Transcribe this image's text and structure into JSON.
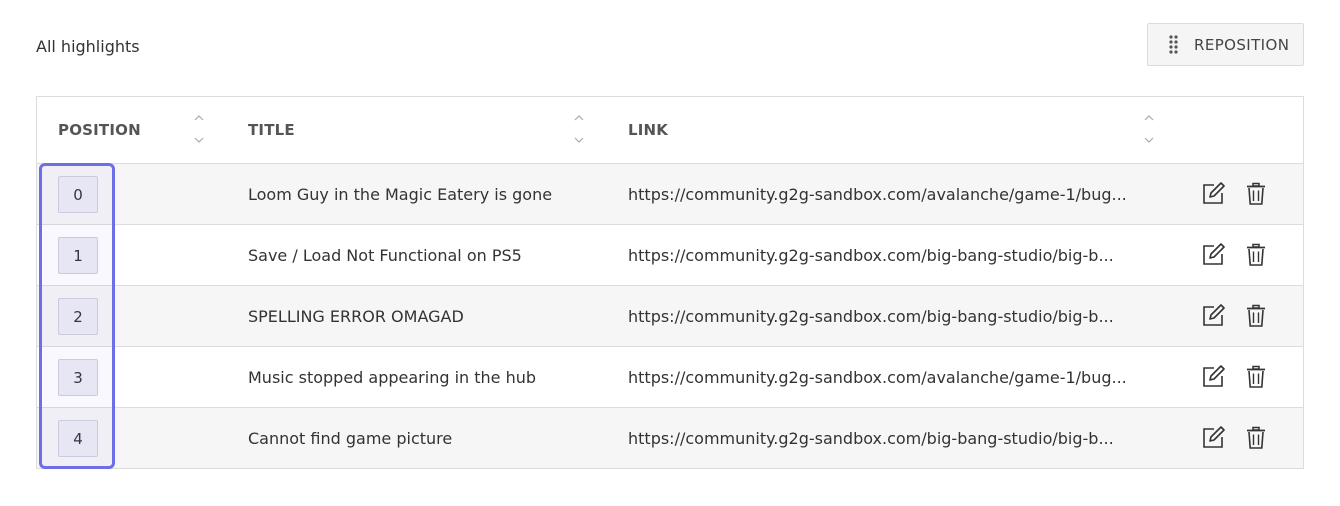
{
  "header": {
    "title": "All highlights",
    "reposition_label": "REPOSITION"
  },
  "table": {
    "columns": {
      "position": "POSITION",
      "title": "TITLE",
      "link": "LINK"
    },
    "rows": [
      {
        "position": "0",
        "title": "Loom Guy in the Magic Eatery is gone",
        "link": "https://community.g2g-sandbox.com/avalanche/game-1/bug..."
      },
      {
        "position": "1",
        "title": "Save / Load Not Functional on PS5",
        "link": "https://community.g2g-sandbox.com/big-bang-studio/big-b..."
      },
      {
        "position": "2",
        "title": "SPELLING ERROR OMAGAD",
        "link": "https://community.g2g-sandbox.com/big-bang-studio/big-b..."
      },
      {
        "position": "3",
        "title": "Music stopped appearing in the hub",
        "link": "https://community.g2g-sandbox.com/avalanche/game-1/bug..."
      },
      {
        "position": "4",
        "title": "Cannot find game picture",
        "link": "https://community.g2g-sandbox.com/big-bang-studio/big-b..."
      }
    ]
  },
  "icons": {
    "drag": "drag-handle-icon",
    "sort": "sort-icon",
    "edit": "edit-icon",
    "delete": "trash-icon"
  },
  "colors": {
    "selection_outline": "#6d6ee8",
    "row_alt": "#f6f6f6",
    "border": "#dcdcdc"
  }
}
